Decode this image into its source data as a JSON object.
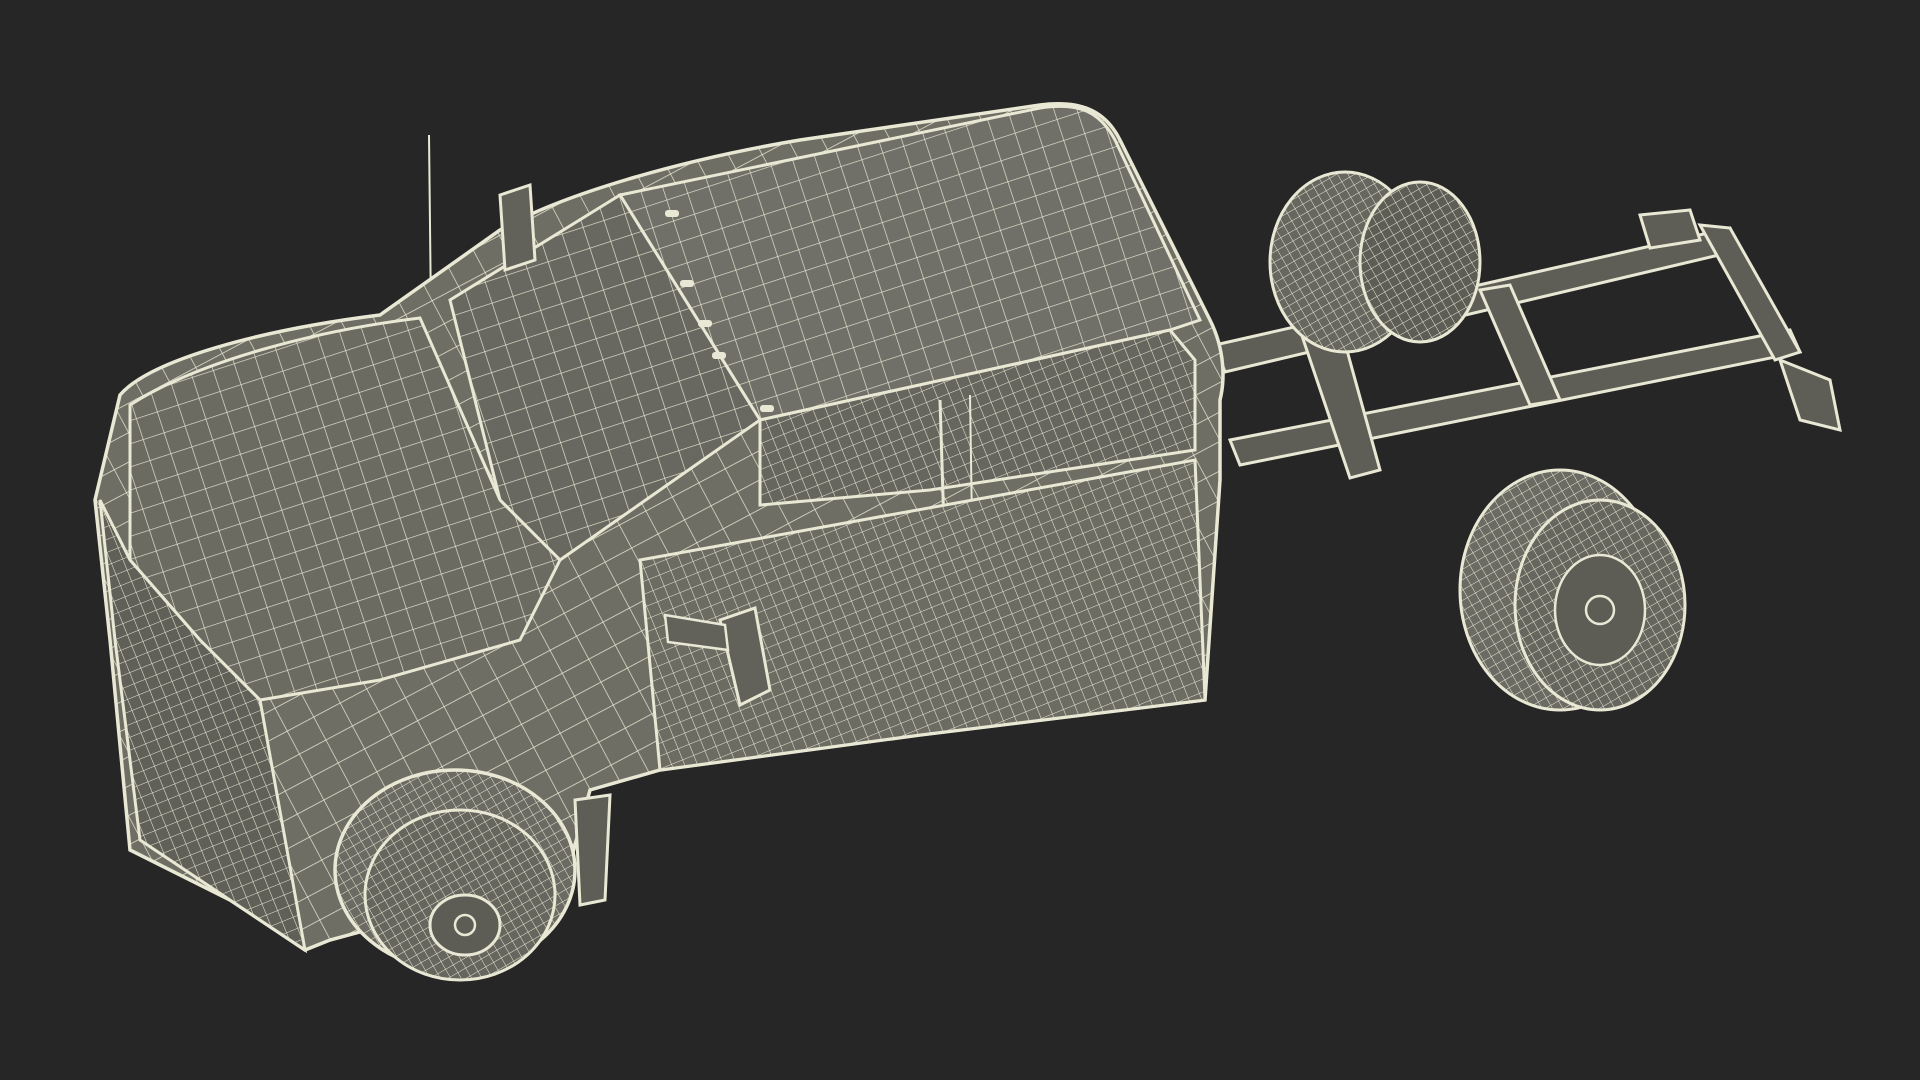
{
  "scene": {
    "background": "#262626",
    "mesh_fill": "#6e6e64",
    "mesh_fill_dark": "#5a5a52",
    "wire_color": "#e9e8d4",
    "subject": "wireframe-pickup-truck-chassis-cab"
  }
}
